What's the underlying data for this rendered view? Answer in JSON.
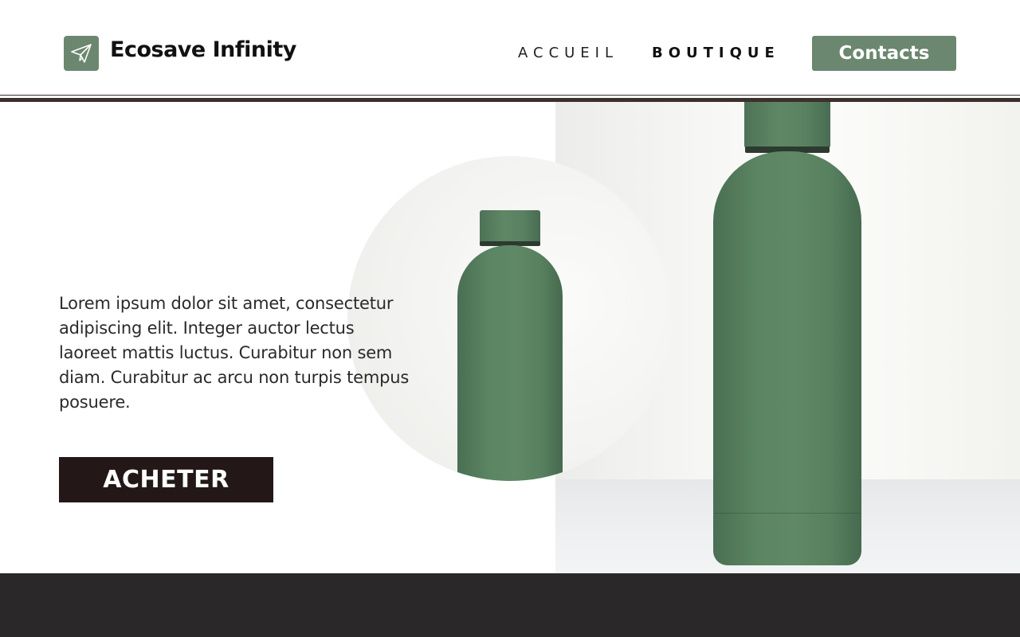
{
  "header": {
    "brand": "Ecosave Infinity",
    "logo_icon": "paper-plane-icon",
    "nav": [
      {
        "label": "ACCUEIL",
        "active": false
      },
      {
        "label": "BOUTIQUE",
        "active": true
      }
    ],
    "contact_label": "Contacts"
  },
  "hero": {
    "text": "Lorem ipsum dolor sit amet, consectetur adipiscing elit. Integer auctor lectus laoreet mattis luctus. Curabitur non sem diam. Curabitur ac arcu non turpis tempus posuere.",
    "buy_label": "ACHETER"
  },
  "colors": {
    "accent": "#6b876f",
    "button_dark": "#231817",
    "footer": "#2a2829",
    "rule": "#3b302b"
  }
}
